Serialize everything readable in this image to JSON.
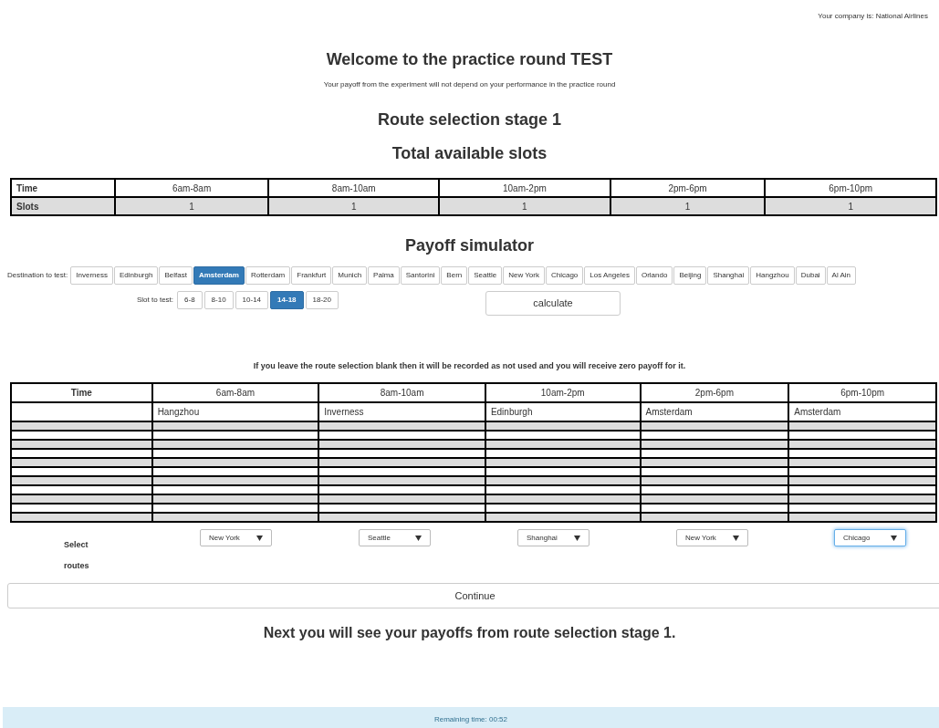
{
  "company_note": "Your company is: National Airlines",
  "title": "Welcome to the practice round TEST",
  "subtitle": "Your payoff from the experiment will not depend on your performance in the practice round",
  "stage_heading": "Route selection stage 1",
  "slots_heading": "Total available slots",
  "slots_table": {
    "columns": [
      "Time",
      "6am-8am",
      "8am-10am",
      "10am-2pm",
      "2pm-6pm",
      "6pm-10pm"
    ],
    "rows": [
      [
        "Slots",
        "1",
        "1",
        "1",
        "1",
        "1"
      ]
    ]
  },
  "simulator_heading": "Payoff simulator",
  "destination_label": "Destination to test:",
  "destinations": [
    {
      "label": "Inverness",
      "selected": false
    },
    {
      "label": "Edinburgh",
      "selected": false
    },
    {
      "label": "Belfast",
      "selected": false
    },
    {
      "label": "Amsterdam",
      "selected": true
    },
    {
      "label": "Rotterdam",
      "selected": false
    },
    {
      "label": "Frankfurt",
      "selected": false
    },
    {
      "label": "Munich",
      "selected": false
    },
    {
      "label": "Palma",
      "selected": false
    },
    {
      "label": "Santorini",
      "selected": false
    },
    {
      "label": "Bern",
      "selected": false
    },
    {
      "label": "Seattle",
      "selected": false
    },
    {
      "label": "New York",
      "selected": false
    },
    {
      "label": "Chicago",
      "selected": false
    },
    {
      "label": "Los Angeles",
      "selected": false
    },
    {
      "label": "Orlando",
      "selected": false
    },
    {
      "label": "Beijing",
      "selected": false
    },
    {
      "label": "Shanghai",
      "selected": false
    },
    {
      "label": "Hangzhou",
      "selected": false
    },
    {
      "label": "Dubai",
      "selected": false
    },
    {
      "label": "Al Ain",
      "selected": false
    }
  ],
  "slot_label": "Slot to test:",
  "slots": [
    {
      "label": "6-8",
      "selected": false
    },
    {
      "label": "8-10",
      "selected": false
    },
    {
      "label": "10-14",
      "selected": false
    },
    {
      "label": "14-18",
      "selected": true
    },
    {
      "label": "18-20",
      "selected": false
    }
  ],
  "calculate_button": "calculate",
  "warning": "If you leave the route selection blank then it will be recorded as not used and you will receive zero payoff for it.",
  "routes_table": {
    "columns": [
      "Time",
      "6am-8am",
      "8am-10am",
      "10am-2pm",
      "2pm-6pm",
      "6pm-10pm"
    ],
    "rows": [
      [
        "",
        "Hangzhou",
        "Inverness",
        "Edinburgh",
        "Amsterdam",
        "Amsterdam"
      ]
    ],
    "empty_rows": [
      {
        "shaded": true
      },
      {
        "shaded": false
      },
      {
        "shaded": true
      },
      {
        "shaded": false
      },
      {
        "shaded": true
      },
      {
        "shaded": false
      },
      {
        "shaded": true
      },
      {
        "shaded": false
      },
      {
        "shaded": true
      },
      {
        "shaded": false
      },
      {
        "shaded": true
      }
    ]
  },
  "select_label_lines": [
    "Select",
    "routes"
  ],
  "route_selects": [
    {
      "value": "New York",
      "focused": false
    },
    {
      "value": "Seattle",
      "focused": false
    },
    {
      "value": "Shanghai",
      "focused": false
    },
    {
      "value": "New York",
      "focused": false
    },
    {
      "value": "Chicago",
      "focused": true
    }
  ],
  "continue_button": "Continue",
  "next_note": "Next you will see your payoffs from route selection stage 1.",
  "remaining_time": "Remaining time: 00:52"
}
